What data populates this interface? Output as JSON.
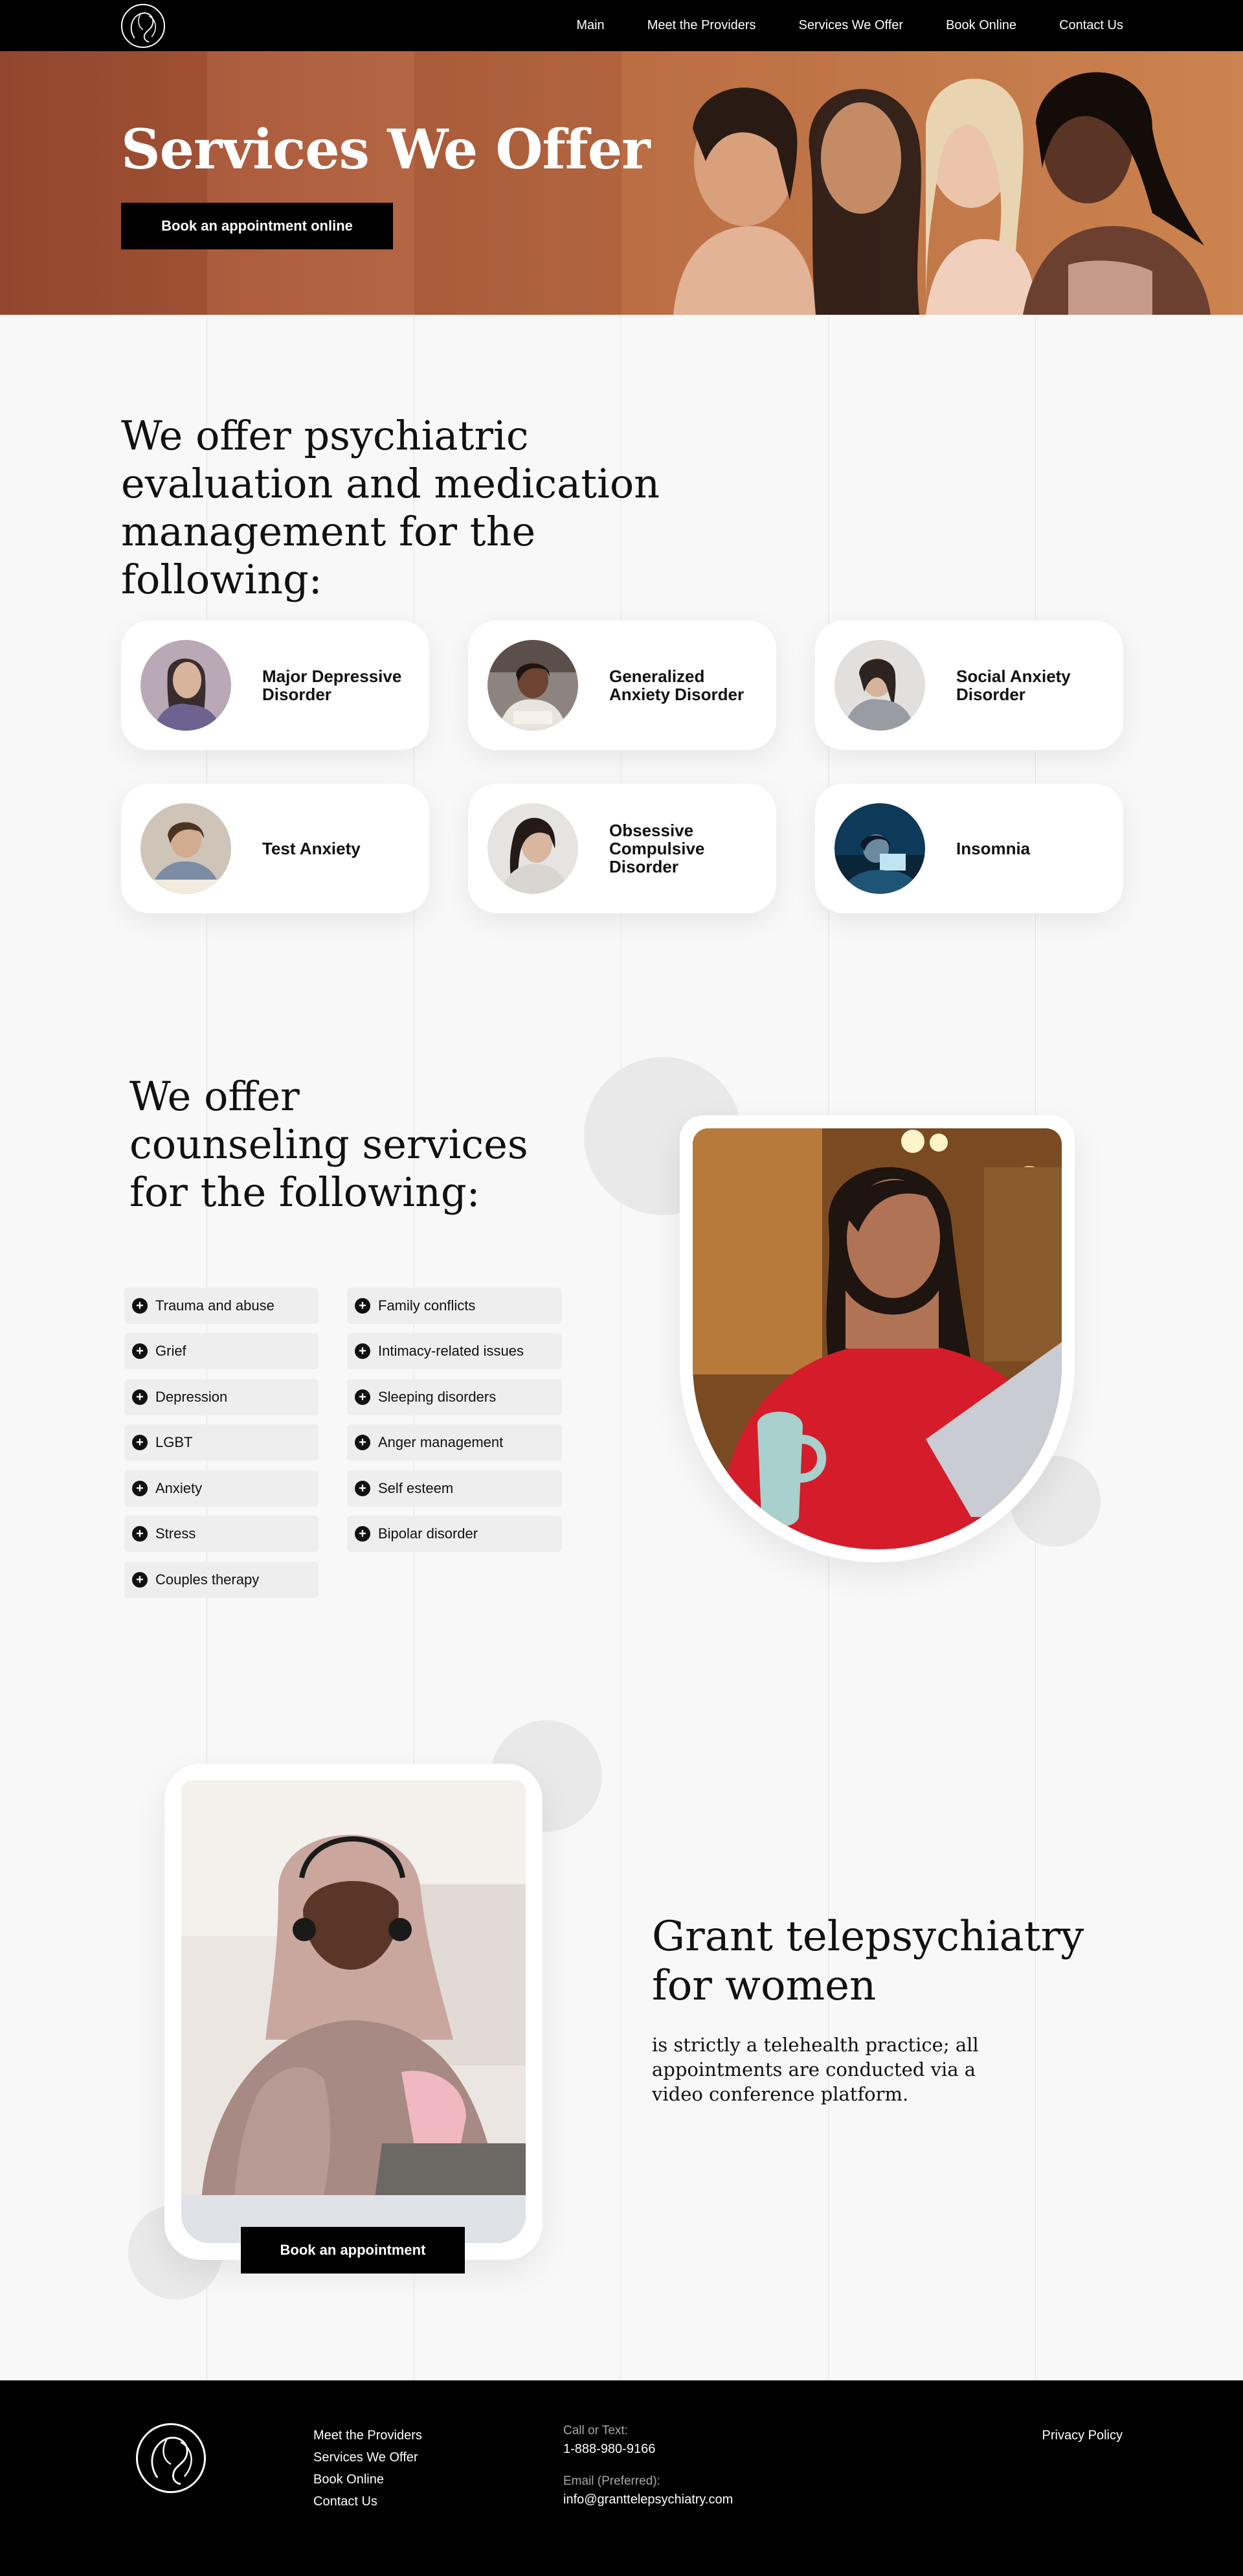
{
  "nav": {
    "items": [
      "Main",
      "Meet the Providers",
      "Services We Offer",
      "Book Online",
      "Contact Us"
    ]
  },
  "hero": {
    "title": "Services We Offer",
    "cta": "Book an appointment online"
  },
  "psychiatric": {
    "title": "We offer psychiatric evaluation and medication management for the following:",
    "conditions": [
      "Major Depressive Disorder",
      "Generalized Anxiety Disorder",
      "Social Anxiety Disorder",
      "Test Anxiety",
      "Obsessive Compulsive Disorder",
      "Insomnia"
    ]
  },
  "counseling": {
    "title": "We offer counseling services for the following:",
    "left_items": [
      "Trauma and abuse",
      "Grief",
      "Depression",
      "LGBT",
      "Anxiety",
      "Stress",
      "Couples therapy"
    ],
    "right_items": [
      "Family conflicts",
      "Intimacy-related issues",
      "Sleeping disorders",
      "Anger management",
      "Self esteem",
      "Bipolar disorder"
    ]
  },
  "telehealth": {
    "title": "Grant telepsychiatry for women",
    "text": "is strictly a telehealth practice; all appointments are conducted via a video conference platform.",
    "cta": "Book an appointment"
  },
  "footer": {
    "links": [
      "Meet the Providers",
      "Services We Offer",
      "Book Online",
      "Contact Us"
    ],
    "phone_label": "Call or Text:",
    "phone": "1-888-980-9166",
    "email_label": "Email (Preferred):",
    "email": "info@granttelepsychiatry.com",
    "privacy": "Privacy Policy"
  },
  "colors": {
    "black": "#000000",
    "hero_terracotta": "#ab5838",
    "background": "#f8f8f8"
  }
}
